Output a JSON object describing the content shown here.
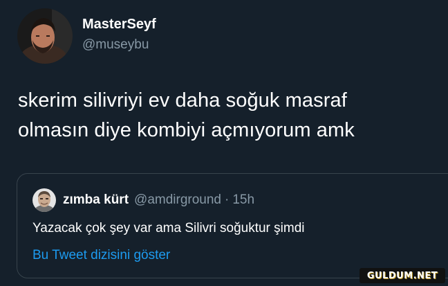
{
  "tweet": {
    "author": {
      "display_name": "MasterSeyf",
      "handle": "@museybu",
      "avatar_icon": "user-photo-avatar"
    },
    "text_lines": [
      "skerim silivriyi ev daha soğuk masraf",
      "olmasın diye kombiyi açmıyorum amk"
    ]
  },
  "quoted_tweet": {
    "author": {
      "display_name": "zımba kürt",
      "handle": "@amdirground",
      "avatar_icon": "user-photo-avatar"
    },
    "separator": "·",
    "time": "15h",
    "text": "Yazacak çok şey var ama Silivri soğuktur şimdi",
    "thread_link": "Bu Tweet dizisini göster"
  },
  "watermark": {
    "text": "GULDUM.NET"
  },
  "colors": {
    "background": "#15202b",
    "primary_text": "#ffffff",
    "secondary_text": "#8899a6",
    "link": "#1d9bf0",
    "border": "#38444d"
  }
}
